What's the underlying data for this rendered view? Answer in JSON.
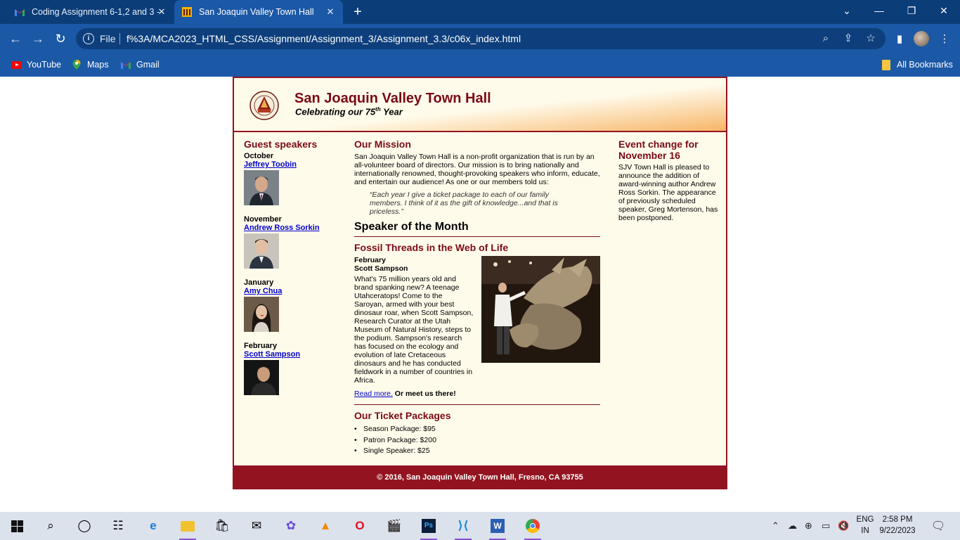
{
  "browser": {
    "tabs": [
      {
        "title": "Coding Assignment 6-1,2 and 3 -",
        "favicon": "gmail-icon"
      },
      {
        "title": "San Joaquin Valley Town Hall",
        "favicon": "town-hall-icon"
      }
    ],
    "address": {
      "scheme_label": "File",
      "url": "f%3A/MCA2023_HTML_CSS/Assignment/Assignment_3/Assignment_3.3/c06x_index.html"
    },
    "bookmarks": [
      "YouTube",
      "Maps",
      "Gmail"
    ],
    "all_bookmarks": "All Bookmarks"
  },
  "page": {
    "header": {
      "title": "San Joaquin Valley Town Hall",
      "subtitle_before": "Celebrating our ",
      "subtitle_num": "75",
      "subtitle_sup": "th",
      "subtitle_after": " Year"
    },
    "guest": {
      "heading": "Guest speakers",
      "speakers": [
        {
          "month": "October",
          "name": "Jeffrey Toobin"
        },
        {
          "month": "November",
          "name": "Andrew Ross Sorkin"
        },
        {
          "month": "January",
          "name": "Amy Chua"
        },
        {
          "month": "February",
          "name": "Scott Sampson"
        }
      ]
    },
    "mission": {
      "heading": "Our Mission",
      "text": "San Joaquin Valley Town Hall is a non-profit organization that is run by an all-volunteer board of directors. Our mission is to bring nationally and internationally renowned, thought-provoking speakers who inform, educate, and entertain our audience! As one or our members told us:",
      "quote": "“Each year I give a ticket package to each of our family members. I think of it as the gift of knowledge...and that is priceless.”"
    },
    "som": {
      "heading": "Speaker of the Month",
      "talk": "Fossil Threads in the Web of Life",
      "month": "February",
      "speaker": "Scott Sampson",
      "text": "What's 75 million years old and brand spanking new? A teenage Utahceratops! Come to the Saroyan, armed with your best dinosaur roar, when Scott Sampson, Research Curator at the Utah Museum of Natural History, steps to the podium. Sampson's research has focused on the ecology and evolution of late Cretaceous dinosaurs and he has conducted fieldwork in a number of countries in Africa.",
      "read_more": "Read more.",
      "meet": "Or meet us there!"
    },
    "tickets": {
      "heading": "Our Ticket Packages",
      "items": [
        "Season Package: $95",
        "Patron Package: $200",
        "Single Speaker: $25"
      ]
    },
    "event": {
      "heading": "Event change for November 16",
      "text": "SJV Town Hall is pleased to announce the addition of award-winning author Andrew Ross Sorkin. The appearance of previously scheduled speaker, Greg Mortenson, has been postponed."
    },
    "footer": "© 2016, San Joaquin Valley Town Hall, Fresno, CA 93755"
  },
  "taskbar": {
    "lang_1": "ENG",
    "lang_2": "IN",
    "time": "2:58 PM",
    "date": "9/22/2023"
  }
}
